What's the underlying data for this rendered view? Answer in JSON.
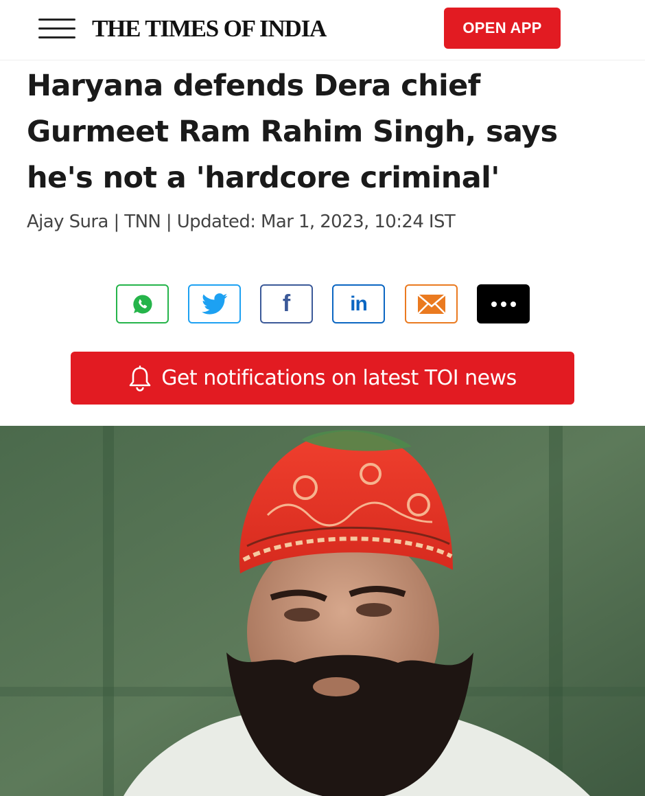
{
  "header": {
    "logo": "THE TIMES OF INDIA",
    "open_app_label": "OPEN APP",
    "accent_color": "#e21b22"
  },
  "article": {
    "headline": "Haryana defends Dera chief Gurmeet Ram Rahim Singh, says he's not a 'hardcore criminal'",
    "byline": "Ajay Sura | TNN | Updated: Mar 1, 2023, 10:24 IST"
  },
  "share": [
    {
      "name": "whatsapp",
      "icon": "whatsapp-icon",
      "color": "#25b44a"
    },
    {
      "name": "twitter",
      "icon": "twitter-icon",
      "color": "#1da1f2"
    },
    {
      "name": "facebook",
      "icon": "facebook-icon",
      "color": "#3b5998"
    },
    {
      "name": "linkedin",
      "icon": "linkedin-icon",
      "color": "#0b66c2"
    },
    {
      "name": "email",
      "icon": "mail-icon",
      "color": "#ea7a20"
    },
    {
      "name": "more",
      "icon": "more-dots-icon",
      "color": "#000000"
    }
  ],
  "notify": {
    "label": "Get notifications on latest TOI news",
    "icon": "bell-icon"
  },
  "photo": {
    "subject": "man-with-red-embroidered-cap-and-beard"
  }
}
